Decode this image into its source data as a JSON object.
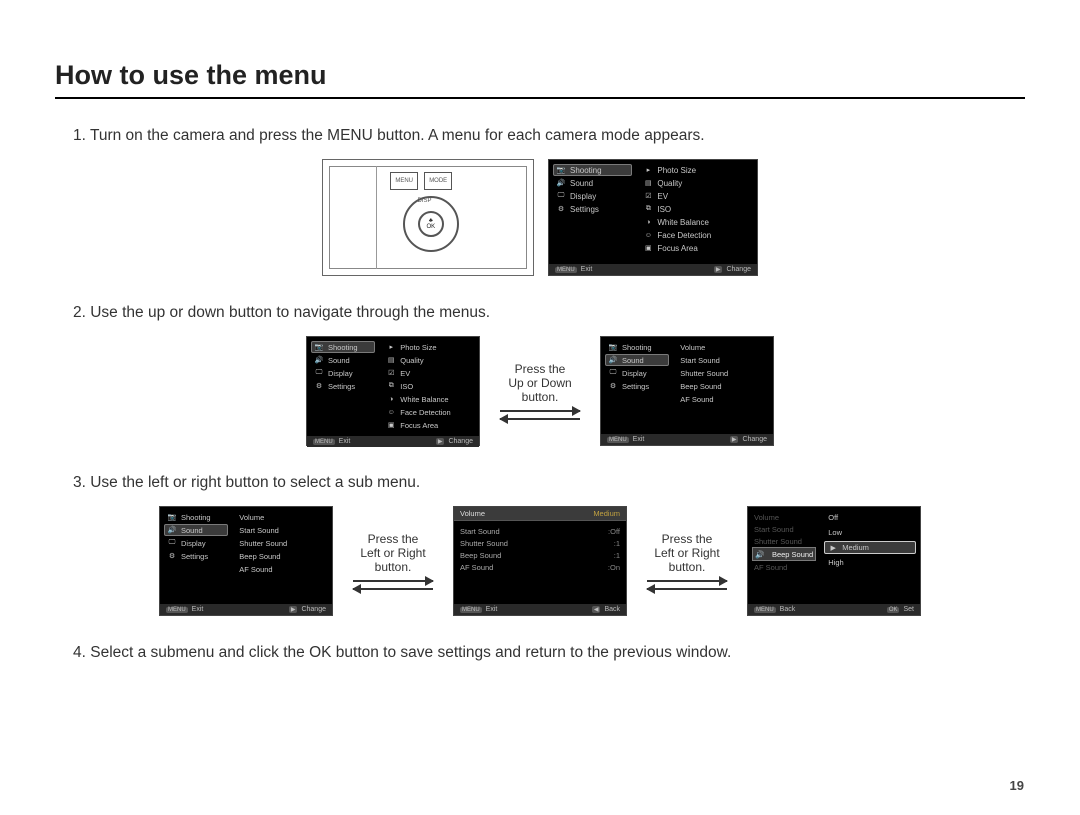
{
  "page_number": "19",
  "title": "How to use the menu",
  "steps": {
    "s1": "1. Turn on the camera and press the MENU button. A menu for each camera mode appears.",
    "s2": "2. Use the up or down button to navigate through the menus.",
    "s3": "3. Use the left or right button to select a sub menu.",
    "s4": "4. Select a submenu and click the OK button to save settings and return to the previous window."
  },
  "drawing": {
    "menu": "MENU",
    "mode": "MODE",
    "disp": "DISP",
    "ok": "OK"
  },
  "guides": {
    "updown_l1": "Press the",
    "updown_l2": "Up or Down",
    "updown_l3": "button.",
    "lr_l1": "Press the",
    "lr_l2": "Left or Right",
    "lr_l3": "button."
  },
  "icons": {
    "camera": "📷",
    "speaker": "🔊",
    "display": "🖵",
    "gear": "⚙",
    "flag": "▸",
    "qual": "▤",
    "ev": "☑",
    "iso": "⧉",
    "wb": "◑",
    "face": "☺",
    "focus": "▣",
    "menu_tag": "MENU",
    "play": "▶",
    "back": "◀",
    "ok": "OK"
  },
  "left_tabs": {
    "shooting": "Shooting",
    "sound": "Sound",
    "display": "Display",
    "settings": "Settings"
  },
  "shooting_sub": {
    "photo_size": "Photo Size",
    "quality": "Quality",
    "ev": "EV",
    "iso": "ISO",
    "wb": "White Balance",
    "face": "Face Detection",
    "focus": "Focus Area"
  },
  "sound_sub": {
    "volume": "Volume",
    "start": "Start Sound",
    "shutter": "Shutter Sound",
    "beep": "Beep Sound",
    "af": "AF Sound"
  },
  "sound_values": {
    "volume": "Medium",
    "start": "Off",
    "shutter": "1",
    "beep": "1",
    "af": "On"
  },
  "volume_options": {
    "off": "Off",
    "low": "Low",
    "medium": "Medium",
    "high": "High"
  },
  "footer": {
    "exit": "Exit",
    "change": "Change",
    "back": "Back",
    "set": "Set"
  }
}
